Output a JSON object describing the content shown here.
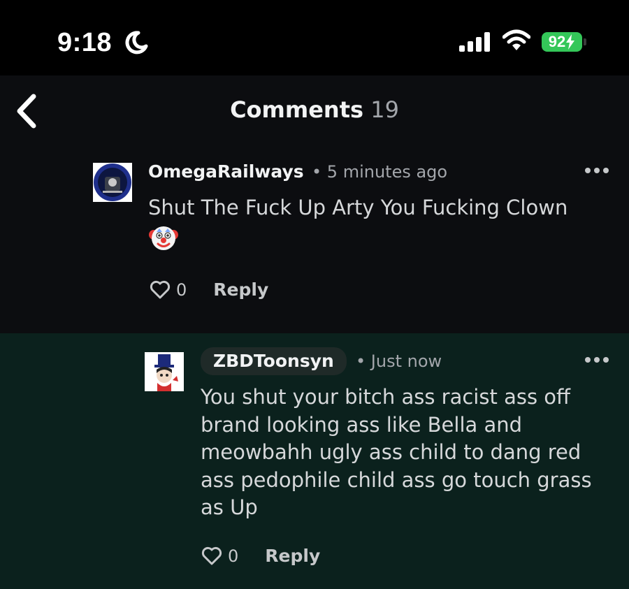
{
  "status_bar": {
    "time": "9:18",
    "battery": "92"
  },
  "nav": {
    "title": "Comments",
    "count": "19"
  },
  "comments": [
    {
      "username": "OmegaRailways",
      "timestamp": "5 minutes ago",
      "text": "Shut The Fuck Up Arty You Fucking Clown",
      "emoji": "clown-face",
      "likes": "0",
      "reply_label": "Reply"
    },
    {
      "username": "ZBDToonsyn",
      "timestamp": "Just now",
      "text": "You shut your bitch ass racist ass off brand looking ass like Bella and meowbahh ugly ass child to dang red ass pedophile child ass go touch grass as Up",
      "likes": "0",
      "reply_label": "Reply"
    }
  ],
  "colors": {
    "background": "#0c0d10",
    "highlight_background": "#0b211d",
    "battery": "#34c759"
  },
  "icons": [
    "moon-icon",
    "signal-icon",
    "wifi-icon",
    "back-chevron-icon",
    "more-icon",
    "heart-icon",
    "clown-face"
  ]
}
